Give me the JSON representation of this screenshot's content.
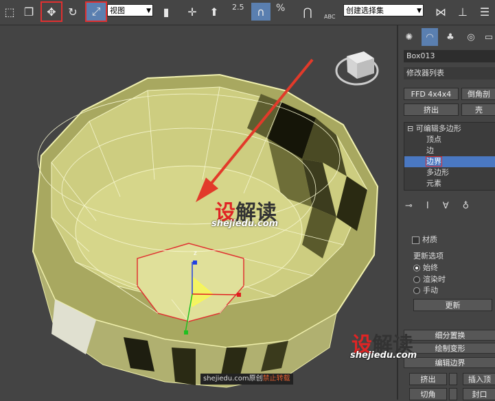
{
  "toolbar": {
    "view_select": "视图",
    "snap_value": "2.5",
    "percent": "%",
    "abc": "ABC",
    "selection_set": "创建选择集"
  },
  "panel": {
    "object_name": "Box013",
    "modifier_list": "修改器列表",
    "btn_ffd": "FFD 4x4x4",
    "btn_chamfer": "倒角剖",
    "btn_extrude": "挤出",
    "btn_shell": "壳",
    "stack": [
      {
        "label": "可编辑多边形"
      },
      {
        "label": "顶点"
      },
      {
        "label": "边"
      },
      {
        "label": "边界"
      },
      {
        "label": "多边形"
      },
      {
        "label": "元素"
      }
    ],
    "material_check": "材质",
    "update_title": "更新选项",
    "radio_always": "始终",
    "radio_render": "渲染时",
    "radio_manual": "手动",
    "update_button": "更新",
    "rollout_subdiv": "细分置换",
    "rollout_paint": "绘制变形",
    "rollout_edit_border": "编辑边界",
    "btn_extrude2": "挤出",
    "btn_insert_vertex": "插入顶",
    "btn_chamfer2": "切角",
    "btn_cap": "封口"
  },
  "viewport": {
    "gizmo_z": "z",
    "watermark_text1": "设",
    "watermark_text2": "解读",
    "watermark_url": "shejiedu.com",
    "footer_site": "shejiedu.com原创",
    "footer_warn": "禁止转载"
  },
  "colors": {
    "accent": "#4a78c2",
    "highlight": "#e03030"
  }
}
